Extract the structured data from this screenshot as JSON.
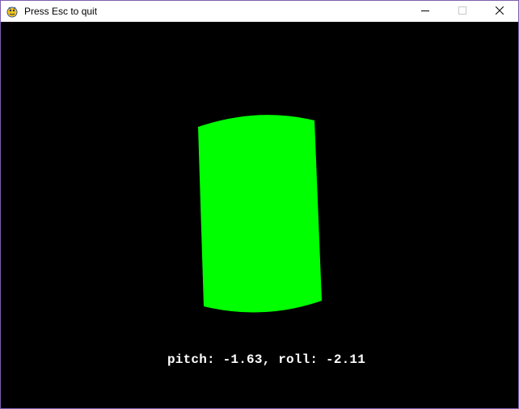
{
  "window": {
    "title": "Press Esc to quit",
    "icon": "pygame-snake-icon"
  },
  "controls": {
    "minimize_icon": "minimize-icon",
    "maximize_icon": "maximize-icon",
    "close_icon": "close-icon"
  },
  "scene": {
    "object": "cylinder",
    "object_color": "#00ff00",
    "background_color": "#000000"
  },
  "readout": {
    "text": "pitch: -1.63, roll: -2.11",
    "pitch": -1.63,
    "roll": -2.11
  }
}
